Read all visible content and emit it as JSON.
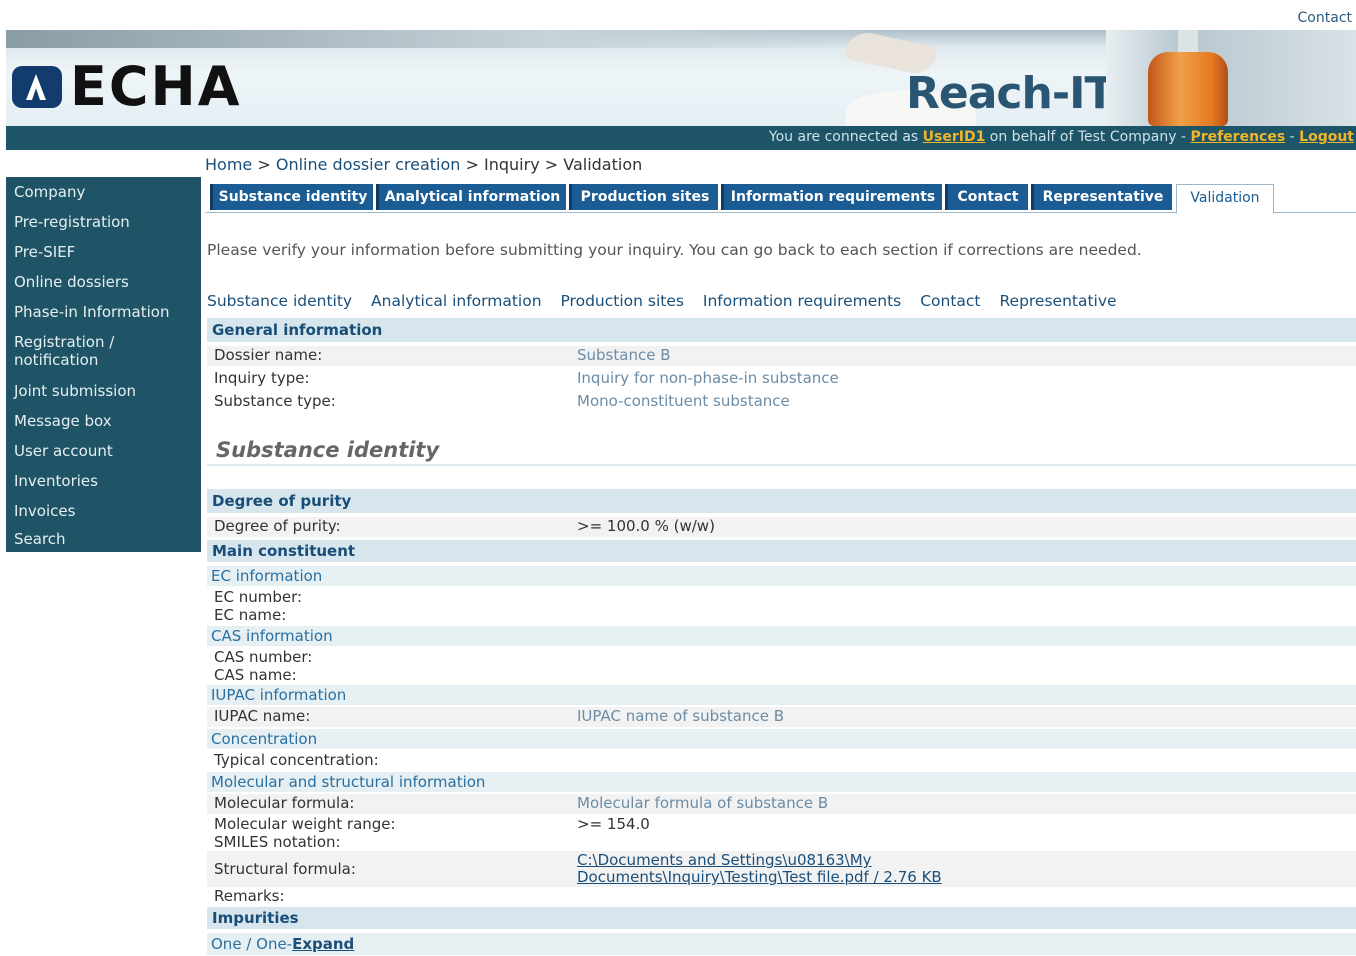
{
  "top": {
    "contact_label": "Contact"
  },
  "banner": {
    "logo_text": "ECHA",
    "app_name": "Reach-IT"
  },
  "connection": {
    "prefix": "You are connected as",
    "user": "UserID1",
    "middle": "on behalf of Test Company -",
    "preferences": "Preferences",
    "sep": "-",
    "logout": "Logout"
  },
  "breadcrumb": {
    "home": "Home",
    "sep1": ">",
    "dossier": "Online dossier creation",
    "rest": "> Inquiry > Validation"
  },
  "sidebar": {
    "items": [
      {
        "label": "Company"
      },
      {
        "label": "Pre-registration"
      },
      {
        "label": "Pre-SIEF"
      },
      {
        "label": "Online dossiers"
      },
      {
        "label": "Phase-in Information"
      },
      {
        "label": "Registration / notification"
      },
      {
        "label": "Joint submission"
      },
      {
        "label": "Message box"
      },
      {
        "label": "User account"
      },
      {
        "label": "Inventories"
      },
      {
        "label": "Invoices"
      },
      {
        "label": "Search"
      }
    ]
  },
  "tabs": [
    {
      "label": "Substance identity"
    },
    {
      "label": "Analytical information"
    },
    {
      "label": "Production sites"
    },
    {
      "label": "Information requirements"
    },
    {
      "label": "Contact"
    },
    {
      "label": "Representative"
    },
    {
      "label": "Validation"
    }
  ],
  "intro": "Please verify your information before submitting your inquiry. You can go back to each section if corrections are needed.",
  "section_links": [
    {
      "label": "Substance identity"
    },
    {
      "label": "Analytical information"
    },
    {
      "label": "Production sites"
    },
    {
      "label": "Information requirements"
    },
    {
      "label": "Contact"
    },
    {
      "label": "Representative"
    }
  ],
  "general": {
    "header": "General information",
    "dossier_name_label": "Dossier name:",
    "dossier_name": "Substance B",
    "inquiry_type_label": "Inquiry type:",
    "inquiry_type": "Inquiry for non-phase-in substance",
    "substance_type_label": "Substance type:",
    "substance_type": "Mono-constituent substance"
  },
  "substance_identity_title": "Substance identity",
  "purity": {
    "header": "Degree of purity",
    "label": "Degree of purity:",
    "value": ">= 100.0   % (w/w)"
  },
  "main_constituent": {
    "header": "Main constituent",
    "ec_info": "EC information",
    "ec_number_label": "EC number:",
    "ec_name_label": "EC name:",
    "cas_info": "CAS information",
    "cas_number_label": "CAS number:",
    "cas_name_label": "CAS name:",
    "iupac_info": "IUPAC information",
    "iupac_name_label": "IUPAC name:",
    "iupac_name": "IUPAC name of substance B",
    "concentration": "Concentration",
    "typical_conc_label": "Typical concentration:",
    "molecular": "Molecular and structural information",
    "formula_label": "Molecular formula:",
    "formula": "Molecular formula of substance B",
    "weight_label": "Molecular weight range:",
    "weight": ">= 154.0",
    "smiles_label": "SMILES notation:",
    "structural_label": "Structural formula:",
    "structural_line1": "C:\\Documents and Settings\\u08163\\My",
    "structural_line2": "Documents\\Inquiry\\Testing\\Test file.pdf / 2.76 KB",
    "remarks_label": "Remarks:"
  },
  "impurities": {
    "header": "Impurities",
    "item": "One / One-",
    "expand": "Expand"
  }
}
